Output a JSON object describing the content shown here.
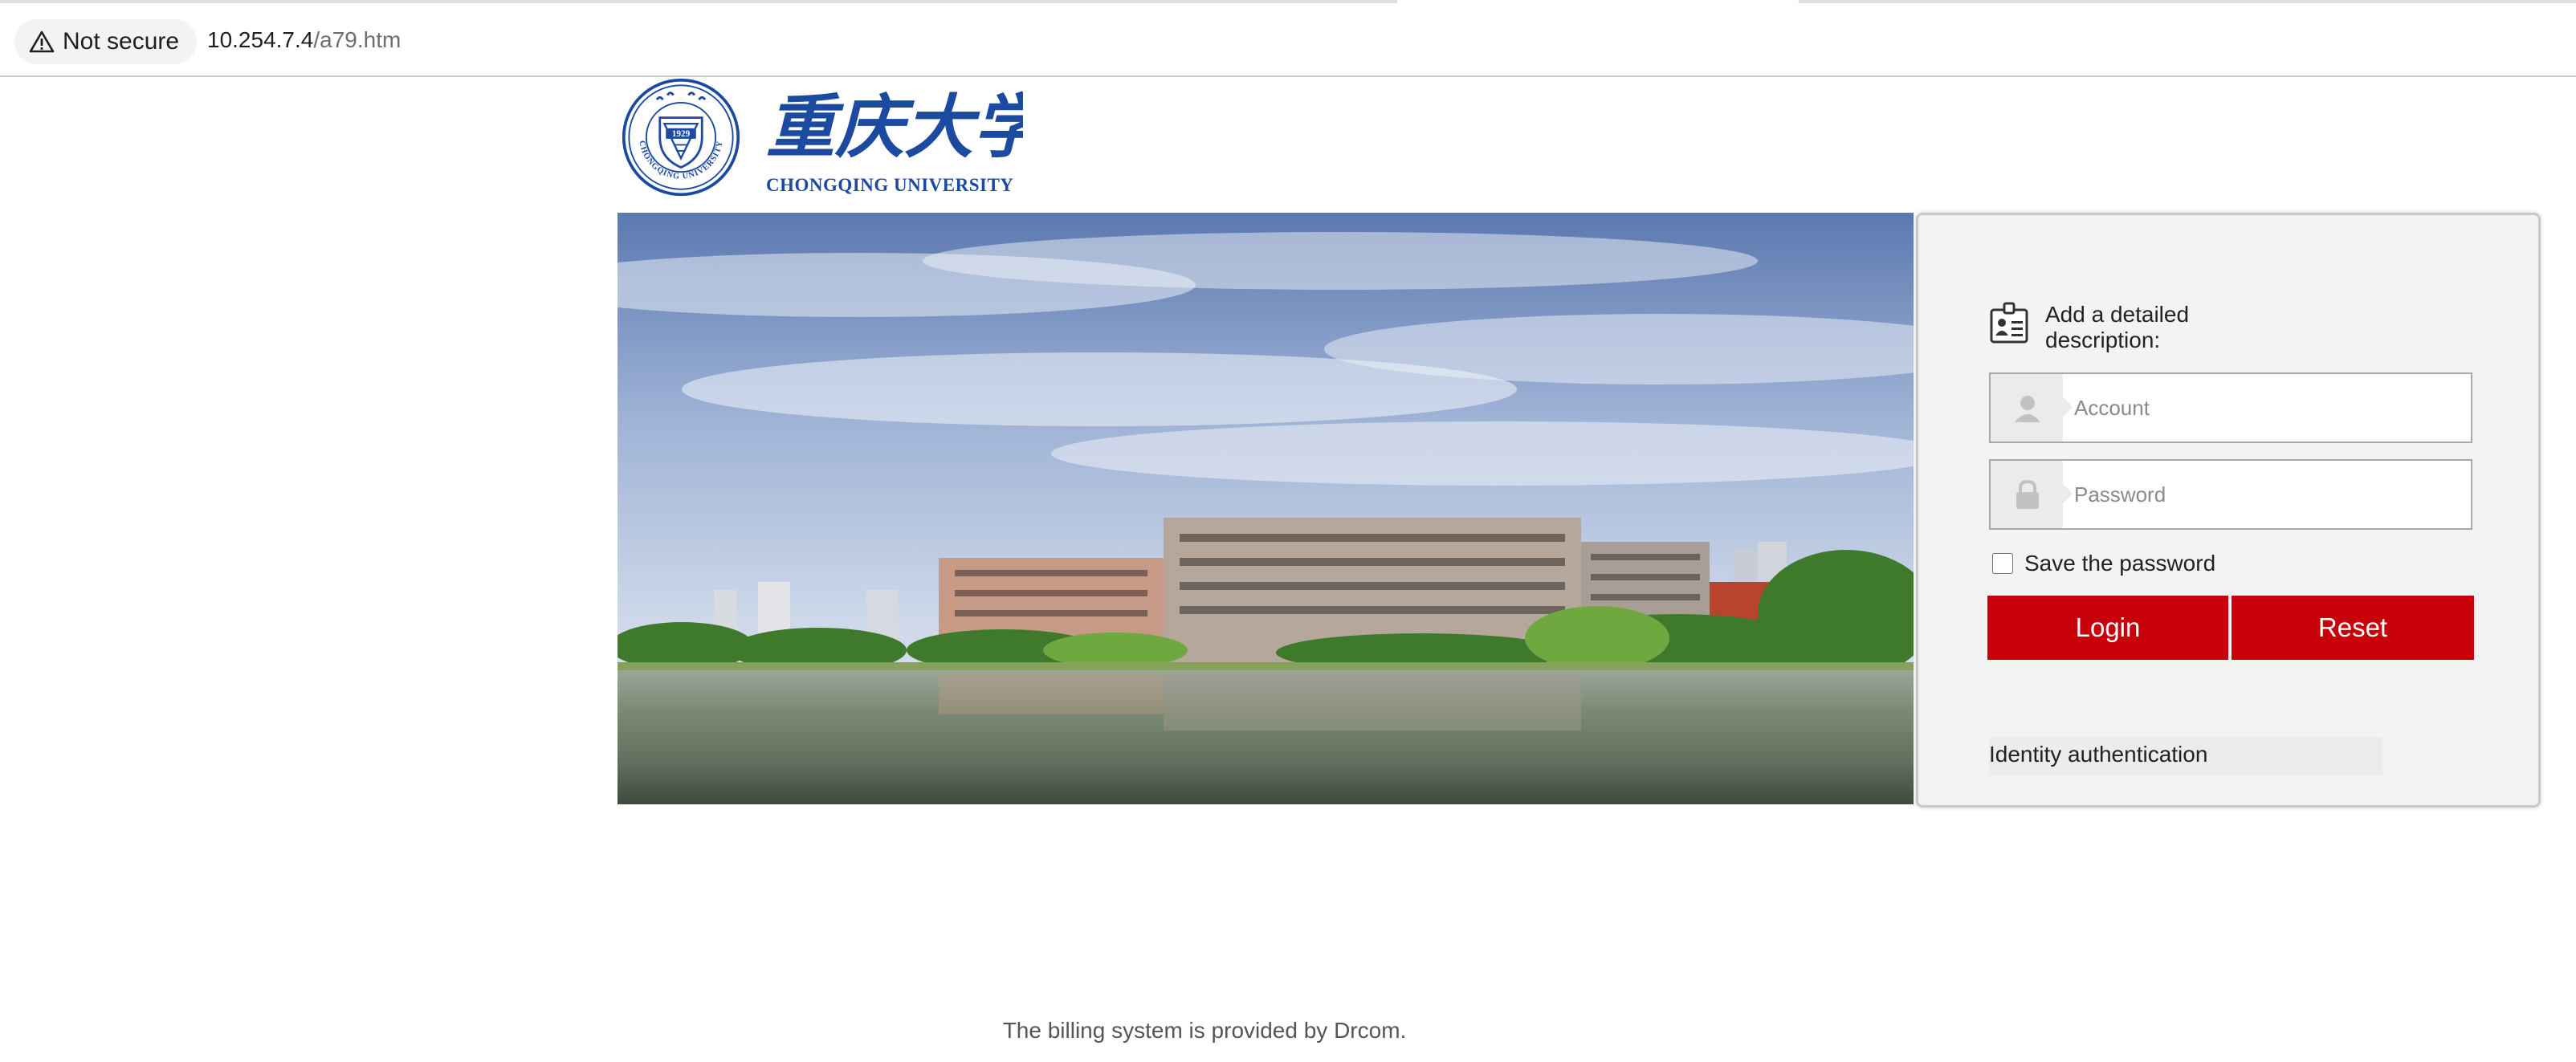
{
  "browser": {
    "security_label": "Not secure",
    "url_host": "10.254.7.4",
    "url_path": "/a79.htm"
  },
  "logo": {
    "name_cn": "重庆大学",
    "name_en": "CHONGQING UNIVERSITY",
    "seal_year": "1929",
    "seal_text": "CHONGQING UNIVERSITY"
  },
  "login": {
    "description_label": "Add a detailed description:",
    "account_placeholder": "Account",
    "password_placeholder": "Password",
    "remember_label": "Save the password",
    "remember_checked": false,
    "login_button": "Login",
    "reset_button": "Reset",
    "identity_auth_link": "Identity authentication"
  },
  "footer": {
    "text": "The billing system is provided by Drcom."
  },
  "colors": {
    "brand_blue": "#1c4aa0",
    "button_red": "#c8000a",
    "panel_bg": "#f3f3f3"
  },
  "icons": [
    "warning-icon",
    "university-seal",
    "id-badge-icon",
    "user-icon",
    "lock-icon"
  ]
}
